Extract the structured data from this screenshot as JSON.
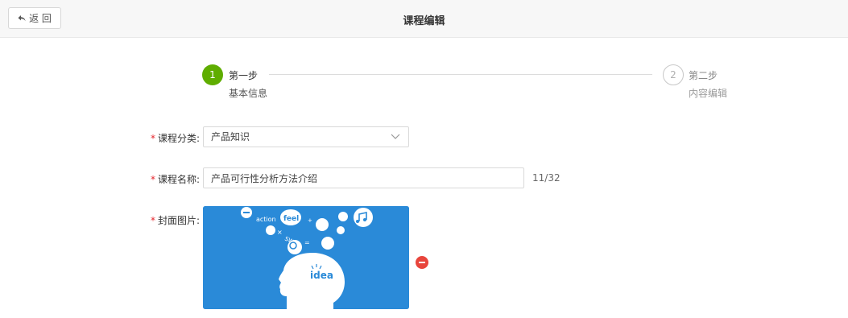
{
  "header": {
    "back_label": "返 回",
    "title": "课程编辑"
  },
  "steps": [
    {
      "number": "1",
      "title": "第一步",
      "desc": "基本信息",
      "state": "active",
      "color": "#5fad00"
    },
    {
      "number": "2",
      "title": "第二步",
      "desc": "内容编辑",
      "state": "pending"
    }
  ],
  "form": {
    "required_mark": "*",
    "category": {
      "label": "课程分类:",
      "value": "产品知识"
    },
    "name": {
      "label": "课程名称:",
      "value": "产品可行性分析方法介绍",
      "counter": "11/32"
    },
    "cover": {
      "label": "封面图片:",
      "image_text": {
        "action": "action",
        "feel": "feel",
        "sw": "SW",
        "idea": "idea"
      },
      "remove_icon": "minus-circle-icon",
      "remove_color": "#e8453c"
    }
  },
  "colors": {
    "accent": "#5fad00",
    "required": "#e5242b",
    "cover_bg": "#2a8ad8"
  }
}
